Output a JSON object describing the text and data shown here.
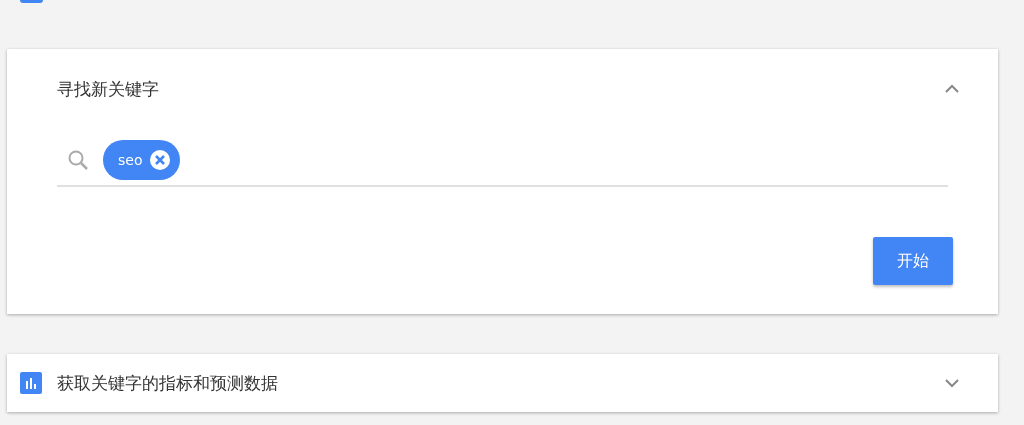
{
  "panels": [
    {
      "title": "寻找新关键字",
      "icon": false,
      "expanded": true,
      "chips": [
        {
          "label": "seo"
        }
      ],
      "action": "开始"
    },
    {
      "title": "获取关键字的指标和预测数据",
      "icon": true,
      "expanded": false
    }
  ]
}
